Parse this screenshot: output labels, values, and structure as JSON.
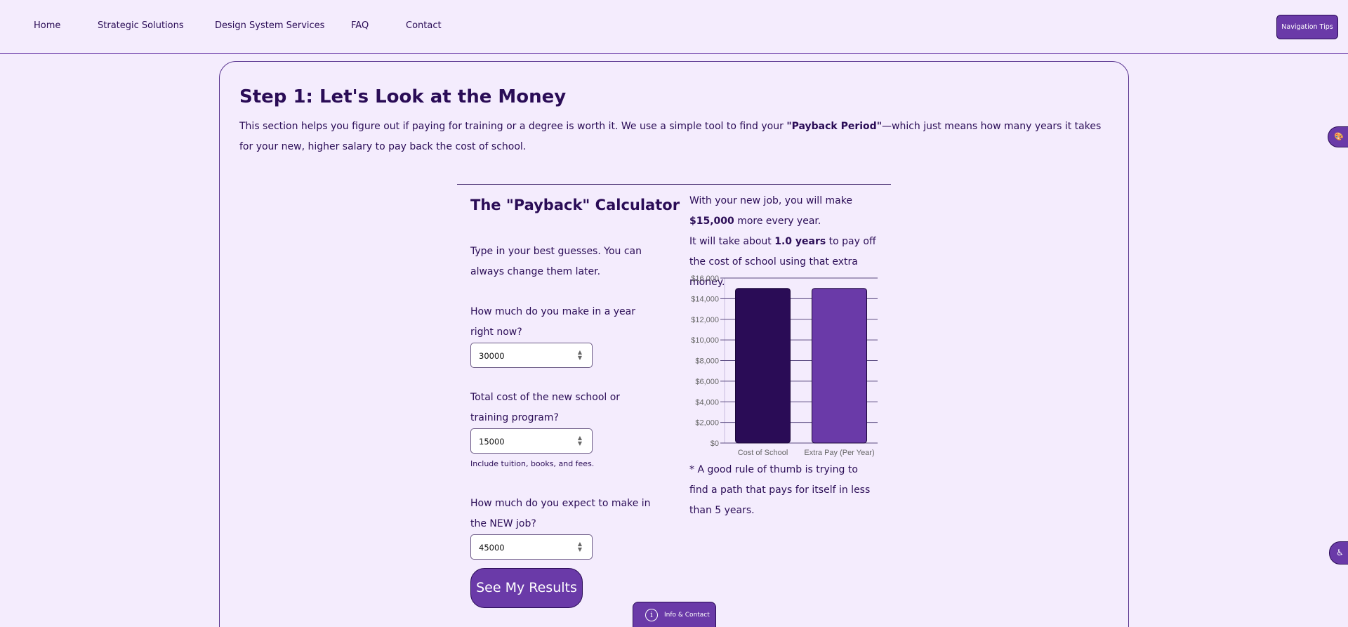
{
  "nav": {
    "items": [
      "Home",
      "Strategic Solutions",
      "Design System Services",
      "FAQ",
      "Contact"
    ],
    "tips_button": "Navigation Tips"
  },
  "step": {
    "title": "Step 1: Let's Look at the Money",
    "intro_before": "This section helps you figure out if paying for training or a degree is worth it. We use a simple tool to find your ",
    "intro_bold": "\"Payback Period\"",
    "intro_after": "—which just means how many years it takes for your new, higher salary to pay back the cost of school."
  },
  "calculator": {
    "title": "The \"Payback\" Calculator",
    "instructions": "Type in your best guesses. You can always change them later.",
    "current_salary_label": "How much do you make in a year right now?",
    "current_salary_value": "30000",
    "cost_label": "Total cost of the new school or training program?",
    "cost_value": "15000",
    "cost_hint": "Include tuition, books, and fees.",
    "new_salary_label": "How much do you expect to make in the NEW job?",
    "new_salary_value": "45000",
    "submit_label": "See My Results"
  },
  "results": {
    "line1_before": "With your new job, you will make ",
    "extra_pay": "$15,000",
    "line1_after": " more every year.",
    "line2_before": "It will take about ",
    "years": "1.0 years",
    "line2_after": " to pay off the cost of school using that extra money.",
    "rule_of_thumb": "* A good rule of thumb is trying to find a path that pays for itself in less than 5 years."
  },
  "chart_data": {
    "type": "bar",
    "categories": [
      "Cost of School",
      "Extra Pay (Per Year)"
    ],
    "values": [
      15000,
      15000
    ],
    "colors": [
      "#2a0c56",
      "#6a3aa8"
    ],
    "ylim": [
      0,
      16000
    ],
    "yticks": [
      "$0",
      "$2,000",
      "$4,000",
      "$6,000",
      "$8,000",
      "$10,000",
      "$12,000",
      "$14,000",
      "$16,000"
    ],
    "ytick_values": [
      0,
      2000,
      4000,
      6000,
      8000,
      10000,
      12000,
      14000,
      16000
    ],
    "grid": true
  },
  "floaters": {
    "palette_icon": "palette-icon",
    "access_icon": "accessibility-icon",
    "info_label": "Info & Contact"
  },
  "colors": {
    "background": "#f4ecfd",
    "primary": "#6a3aa8",
    "dark": "#2a0c56"
  }
}
